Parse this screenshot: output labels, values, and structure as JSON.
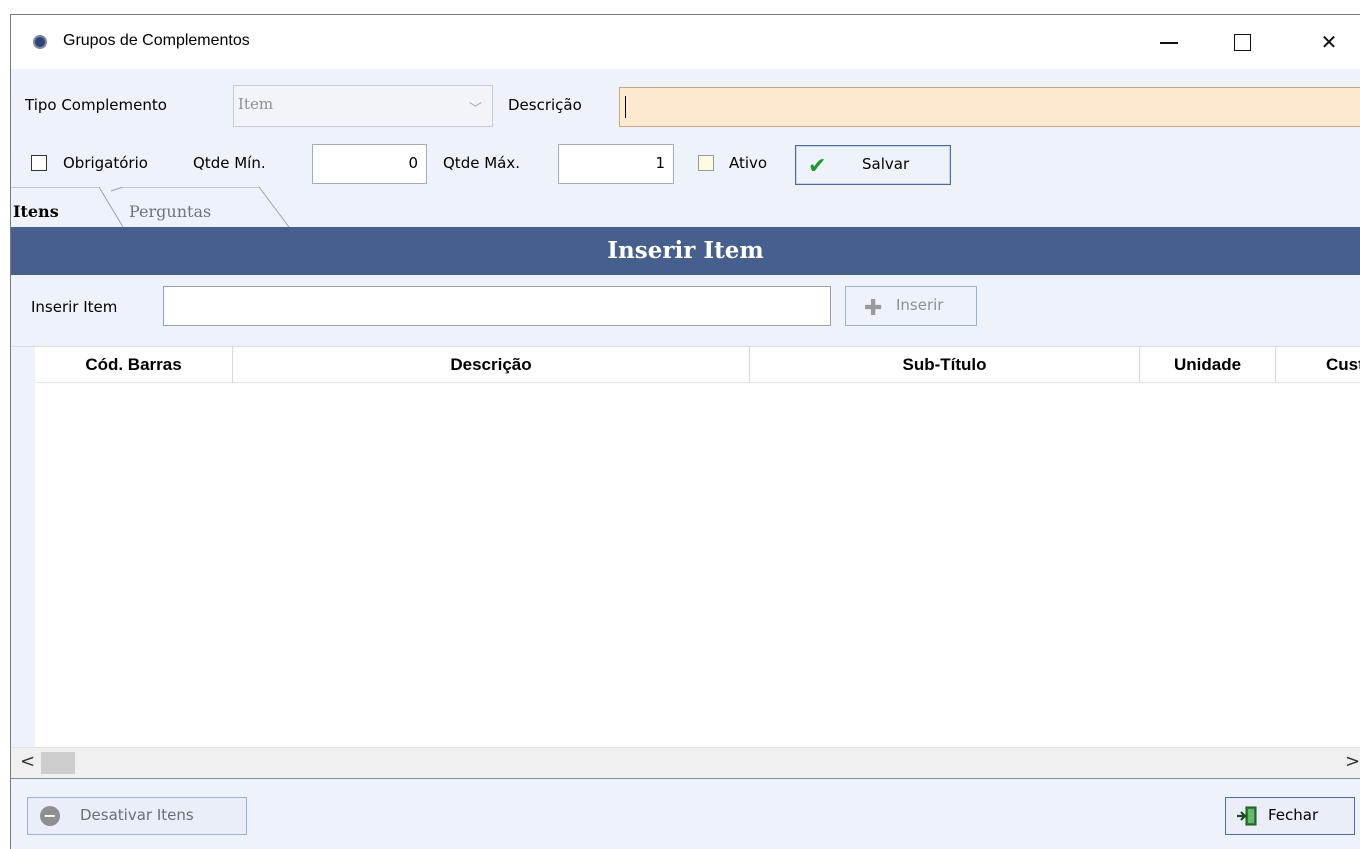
{
  "window": {
    "title": "Grupos de Complementos",
    "minimize_glyph": "—",
    "maximize_glyph": "☐",
    "close_glyph": "✕"
  },
  "form": {
    "tipo_label": "Tipo Complemento",
    "tipo_value": "Item",
    "descricao_label": "Descrição",
    "descricao_value": "",
    "obrigatorio_label": "Obrigatório",
    "obrigatorio_checked": false,
    "qtde_min_label": "Qtde Mín.",
    "qtde_min_value": "0",
    "qtde_max_label": "Qtde Máx.",
    "qtde_max_value": "1",
    "ativo_label": "Ativo",
    "ativo_checked": false,
    "salvar_label": "Salvar"
  },
  "tabs": [
    {
      "label": "Itens",
      "active": true
    },
    {
      "label": "Perguntas",
      "active": false
    }
  ],
  "panel": {
    "banner": "Inserir Item",
    "inserir_label": "Inserir Item",
    "inserir_value": "",
    "inserir_button": "Inserir"
  },
  "grid": {
    "columns": [
      "Cód. Barras",
      "Descrição",
      "Sub-Título",
      "Unidade",
      "Cust"
    ],
    "rows": []
  },
  "scrollbar": {
    "left_arrow": "<",
    "right_arrow": ">"
  },
  "footer": {
    "desativar_label": "Desativar Itens",
    "fechar_label": "Fechar"
  },
  "colors": {
    "accent_banner": "#475f8d",
    "description_field": "#fde9cf",
    "background": "#eef2fb"
  },
  "icons": [
    "app-icon",
    "check-icon",
    "plus-icon",
    "minus-circle-icon",
    "exit-door-icon",
    "chevron-down-icon"
  ]
}
